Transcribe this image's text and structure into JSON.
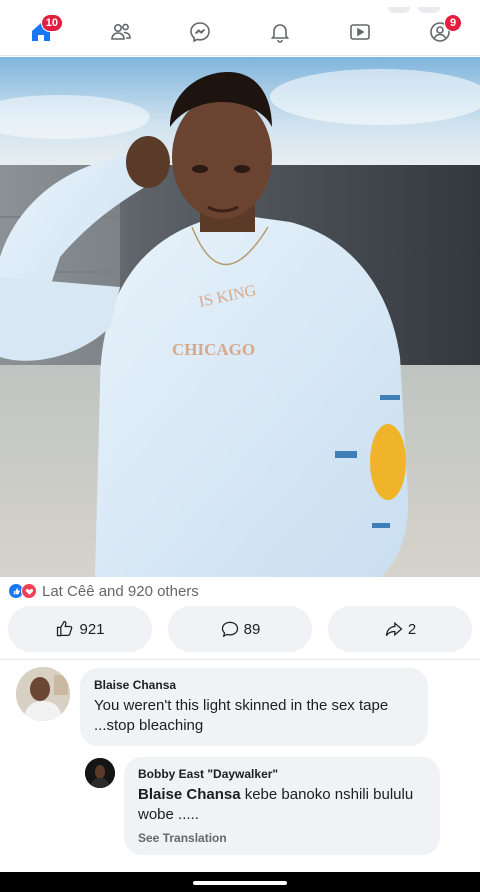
{
  "nav": {
    "home_badge": "10",
    "menu_badge": "9"
  },
  "post": {
    "reactions_text": "Lat Cêê and 920 others",
    "likes_count": "921",
    "comments_count": "89",
    "shares_count": "2",
    "shirt_text_top": "IS KING",
    "shirt_text_city": "CHICAGO"
  },
  "comments": [
    {
      "author": "Blaise Chansa",
      "text": "You weren't this light skinned in the sex tape ...stop bleaching"
    },
    {
      "author": "Bobby East \"Daywalker\"",
      "mention": "Blaise Chansa",
      "text": " kebe banoko nshili bululu wobe .....",
      "translate": "See Translation"
    }
  ],
  "colors": {
    "accent": "#1877f2",
    "badge": "#e41e3f",
    "bubble": "#f0f2f5"
  }
}
